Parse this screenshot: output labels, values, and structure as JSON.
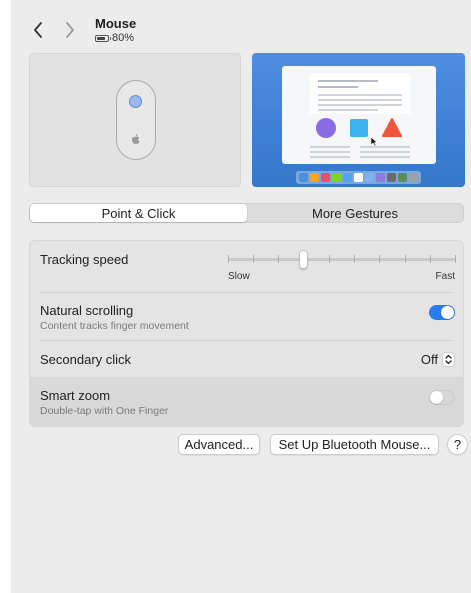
{
  "header": {
    "title": "Mouse",
    "battery_text": "80%",
    "battery_level": 0.8
  },
  "preview": {
    "device_icon": "magic-mouse-icon",
    "dock_colors": [
      "#4a90e2",
      "#f5a623",
      "#e94f6a",
      "#7ed321",
      "#50a7e8",
      "#ffffff",
      "#7fb3f0",
      "#8f7ae0",
      "#6c6c6c",
      "#5a8f5a",
      "#a0a0a0"
    ]
  },
  "tabs": [
    {
      "label": "Point & Click",
      "selected": true
    },
    {
      "label": "More Gestures",
      "selected": false
    }
  ],
  "settings": {
    "tracking_speed": {
      "label": "Tracking speed",
      "min_label": "Slow",
      "max_label": "Fast",
      "value": 0.33,
      "ticks": 10
    },
    "natural_scrolling": {
      "label": "Natural scrolling",
      "description": "Content tracks finger movement",
      "enabled": true
    },
    "secondary_click": {
      "label": "Secondary click",
      "value": "Off"
    },
    "smart_zoom": {
      "label": "Smart zoom",
      "description": "Double-tap with One Finger",
      "enabled": false
    }
  },
  "buttons": {
    "advanced": "Advanced...",
    "setup_bluetooth": "Set Up Bluetooth Mouse...",
    "help": "?"
  },
  "colors": {
    "accent": "#2a7cf0",
    "window_bg": "#ececec"
  }
}
